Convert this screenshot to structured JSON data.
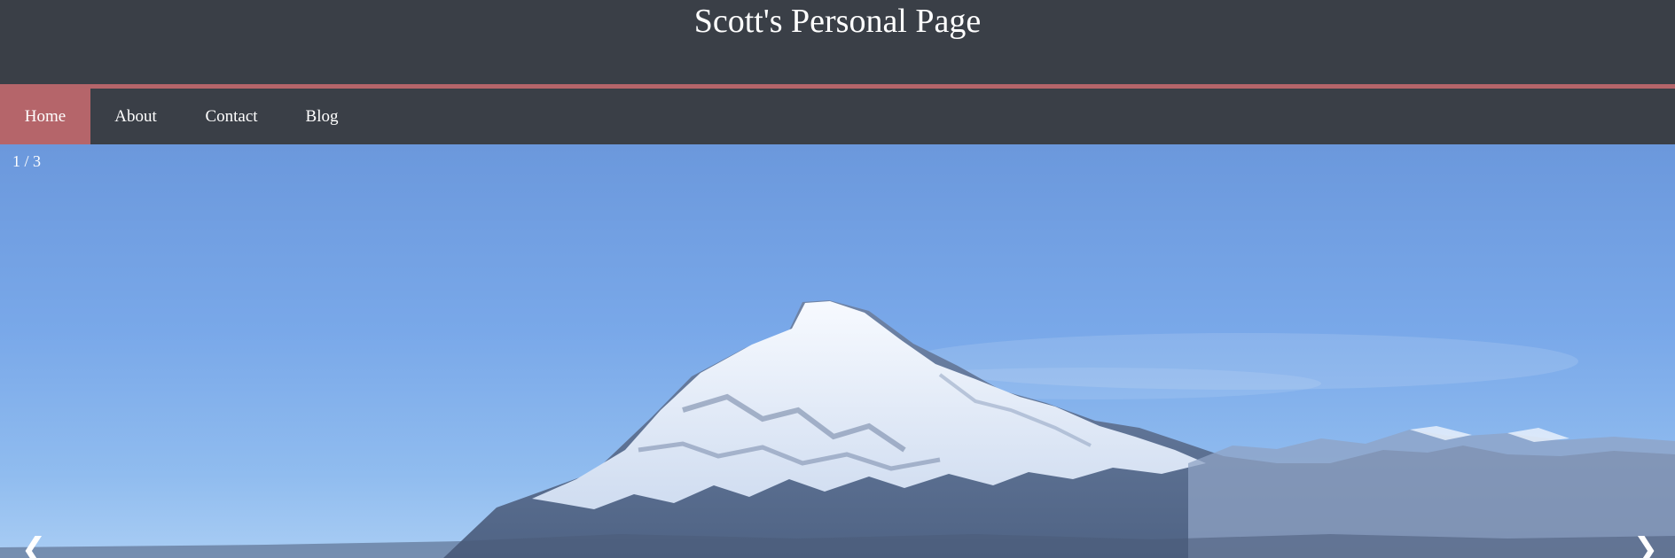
{
  "header": {
    "title": "Scott's Personal Page"
  },
  "nav": {
    "items": [
      {
        "label": "Home",
        "active": true
      },
      {
        "label": "About",
        "active": false
      },
      {
        "label": "Contact",
        "active": false
      },
      {
        "label": "Blog",
        "active": false
      }
    ]
  },
  "slideshow": {
    "counter": "1 / 3",
    "current": 1,
    "total": 3,
    "prev_icon": "chevron-left-icon",
    "next_icon": "chevron-right-icon",
    "prev_glyph": "❮",
    "next_glyph": "❯",
    "image_subject": "snow-capped mountain under blue sky"
  },
  "colors": {
    "header_bg": "#3a3f47",
    "accent": "#b5656a",
    "sky": "#79a8e9",
    "text": "#ffffff"
  }
}
